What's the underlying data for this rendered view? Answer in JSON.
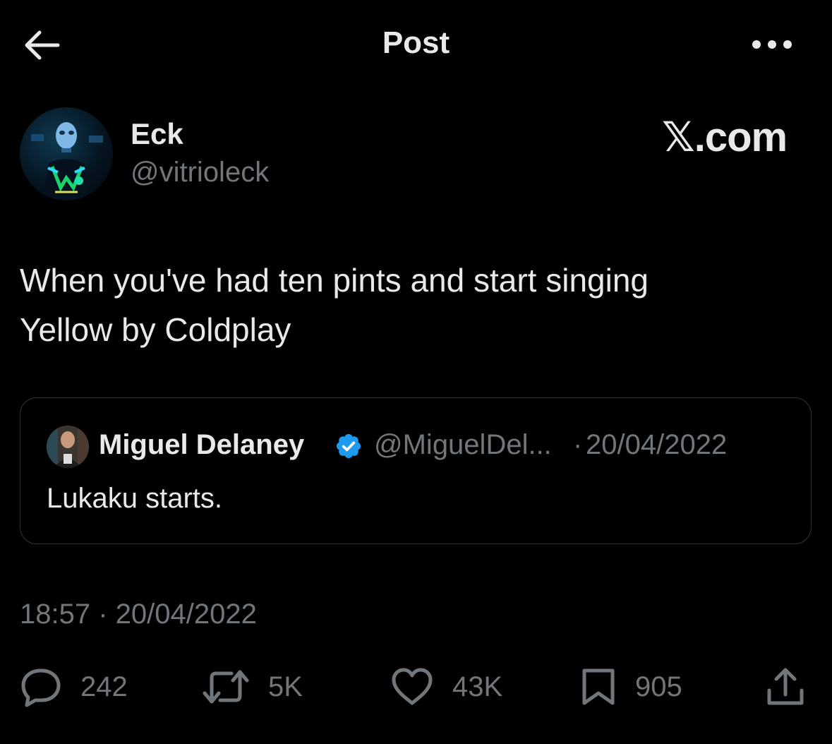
{
  "header": {
    "title": "Post"
  },
  "icons": {
    "back": "arrow-left-icon",
    "more": "more-horizontal-icon",
    "verified": "verified-badge-icon",
    "reply": "reply-icon",
    "repost": "repost-icon",
    "like": "heart-icon",
    "bookmark": "bookmark-icon",
    "share": "share-icon"
  },
  "colors": {
    "background": "#000000",
    "text": "#e7e9ea",
    "secondary": "#71767b",
    "verified": "#1d9bf0",
    "border": "#2f3336"
  },
  "author": {
    "name": "Eck",
    "handle": "@vitrioleck"
  },
  "brand": "𝕏.com",
  "tweet": {
    "text_line1": "When you've had ten pints and start singing",
    "text_line2": "Yellow by Coldplay",
    "time": "18:57",
    "date": "20/04/2022",
    "separator": "·"
  },
  "quote": {
    "name": "Miguel Delaney",
    "handle": "@MiguelDel...",
    "separator": "·",
    "date": "20/04/2022",
    "text": "Lukaku starts."
  },
  "stats": {
    "replies": "242",
    "reposts": "5K",
    "likes": "43K",
    "bookmarks": "905"
  }
}
